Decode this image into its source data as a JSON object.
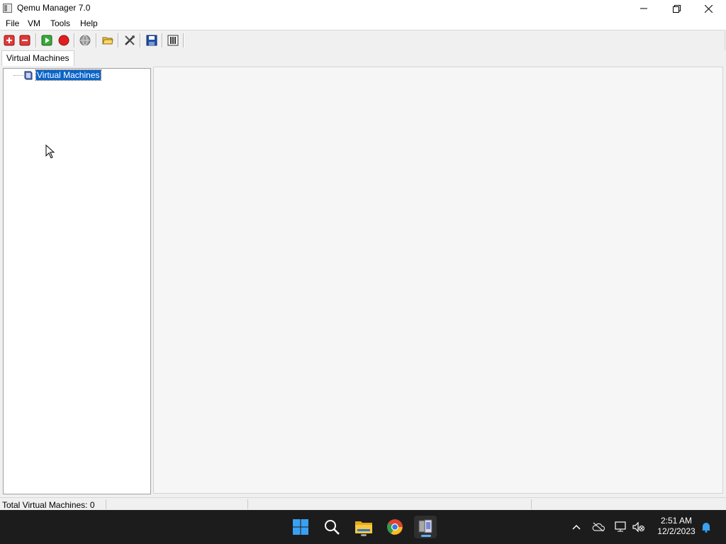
{
  "window": {
    "title": "Qemu Manager 7.0"
  },
  "menu": [
    "File",
    "VM",
    "Tools",
    "Help"
  ],
  "toolbar": {
    "buttons": [
      "add-vm-icon",
      "remove-vm-icon",
      "start-vm-icon",
      "stop-vm-icon",
      "globe-icon",
      "open-folder-icon",
      "tools-icon",
      "save-icon",
      "settings-panel-icon"
    ]
  },
  "tabs": [
    "Virtual Machines"
  ],
  "tree": {
    "root_label": "Virtual Machines"
  },
  "status": {
    "total_label": "Total Virtual Machines: 0"
  },
  "taskbar": {
    "apps": [
      "windows-start-icon",
      "search-icon",
      "file-explorer-icon",
      "chrome-icon",
      "qemu-manager-icon"
    ]
  },
  "clock": {
    "time": "2:51 AM",
    "date": "12/2/2023"
  },
  "colors": {
    "selection": "#0a64c8",
    "taskbar": "#1c1c1c"
  }
}
